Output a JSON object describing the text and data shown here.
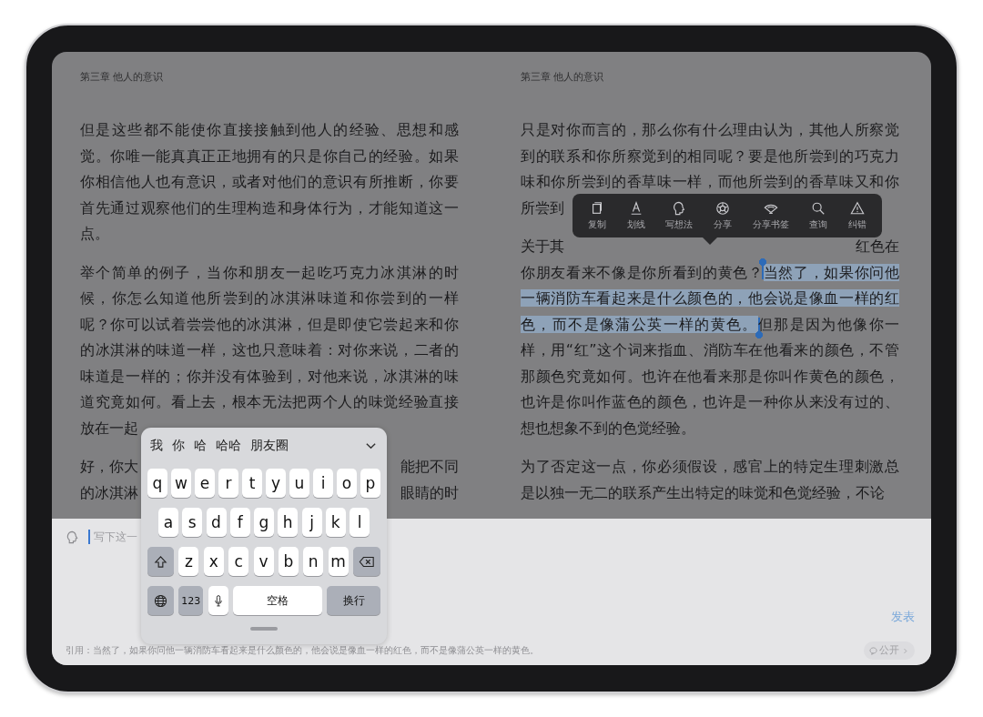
{
  "pages": [
    {
      "chapter": "第三章 他人的意识",
      "paragraphs": [
        [
          "但是这些都不能使你直接接触到他人的经验、思想和感",
          "觉。你唯一能真真正正地拥有的只是你自己的经验。如果",
          "你相信他人也有意识，或者对他们的意识有所推断，你要",
          "首先通过观察他们的生理构造和身体行为，才能知道这一",
          "点。"
        ],
        [
          "举个简单的例子，当你和朋友一起吃巧克力冰淇淋的时",
          "候，你怎么知道他所尝到的冰淇淋味道和你尝到的一样",
          "呢？你可以试着尝尝他的冰淇淋，但是即使它尝起来和你",
          "的冰淇淋的味道一样，这也只意味着：对你来说，二者的",
          "味道是一样的；你并没有体验到，对他来说，冰淇淋的味",
          "道究竟如何。看上去，根本无法把两个人的味觉经验直接",
          {
            "kind": "split",
            "left": "放在一起"
          }
        ],
        [
          {
            "kind": "split",
            "left": "好，你大",
            "right": "能把不同"
          },
          {
            "kind": "split",
            "left": "的冰淇淋",
            "right": "眼睛的时"
          }
        ]
      ]
    },
    {
      "chapter": "第三章 他人的意识",
      "paragraphs": [
        [
          "只是对你而言的，那么你有什么理由认为，其他人所察觉",
          "到的联系和你所察觉到的相同呢？要是他所尝到的巧克力",
          "味和你所尝到的香草味一样，而他所尝到的香草味又和你",
          {
            "kind": "split",
            "left": "所尝到"
          }
        ],
        [
          {
            "kind": "split",
            "left": "关于其",
            "right": "红色在"
          },
          {
            "kind": "selection",
            "segments": [
              {
                "text": "你朋友看来不像是你所看到的黄色？",
                "selected": false
              },
              {
                "text": "当然了，如果你问他",
                "selected": true
              }
            ]
          },
          {
            "kind": "selection",
            "segments": [
              {
                "text": "一辆消防车看起来是什么颜色的，他会说是像血一样的红",
                "selected": true
              }
            ]
          },
          {
            "kind": "selection",
            "segments": [
              {
                "text": "色，而不是像蒲公英一样的黄色。",
                "selected": true
              },
              {
                "text": "但那是因为他像你一",
                "selected": false
              }
            ]
          },
          "样，用“红”这个词来指血、消防车在他看来的颜色，不管",
          "那颜色究竟如何。也许在他看来那是你叫作黄色的颜色，",
          "也许是你叫作蓝色的颜色，也许是一种你从来没有过的、",
          "想也想象不到的色觉经验。"
        ],
        [
          "为了否定这一点，你必须假设，感官上的特定生理刺激总",
          "是以独一无二的联系产生出特定的味觉和色觉经验，不论"
        ]
      ]
    }
  ],
  "selection_menu": [
    {
      "kind": "copy",
      "label": "复制"
    },
    {
      "kind": "underline",
      "label": "划线"
    },
    {
      "kind": "thought",
      "label": "写想法"
    },
    {
      "kind": "share",
      "label": "分享"
    },
    {
      "kind": "bookmark",
      "label": "分享书签"
    },
    {
      "kind": "search",
      "label": "查询"
    },
    {
      "kind": "report",
      "label": "纠错"
    }
  ],
  "keyboard": {
    "candidates": [
      "我",
      "你",
      "哈",
      "哈哈",
      "朋友圈"
    ],
    "rows": [
      {
        "keys": [
          "q",
          "w",
          "e",
          "r",
          "t",
          "y",
          "u",
          "i",
          "o",
          "p"
        ]
      },
      {
        "keys": [
          "a",
          "s",
          "d",
          "f",
          "g",
          "h",
          "j",
          "k",
          "l"
        ]
      },
      {
        "keys": [
          {
            "kind": "shift"
          },
          "z",
          "x",
          "c",
          "v",
          "b",
          "n",
          "m",
          {
            "kind": "backspace"
          }
        ]
      },
      {
        "keys": [
          {
            "kind": "globe"
          },
          {
            "kind": "numbers",
            "label": "123"
          },
          {
            "kind": "mic"
          },
          {
            "kind": "space",
            "label": "空格"
          },
          {
            "kind": "return",
            "label": "换行"
          }
        ]
      }
    ]
  },
  "comment": {
    "placeholder": "写下这一",
    "submit": "发表",
    "quote": "引用：当然了，如果你问他一辆消防车看起来是什么颜色的，他会说是像血一样的红色，而不是像蒲公英一样的黄色。",
    "visibility": "公开"
  }
}
